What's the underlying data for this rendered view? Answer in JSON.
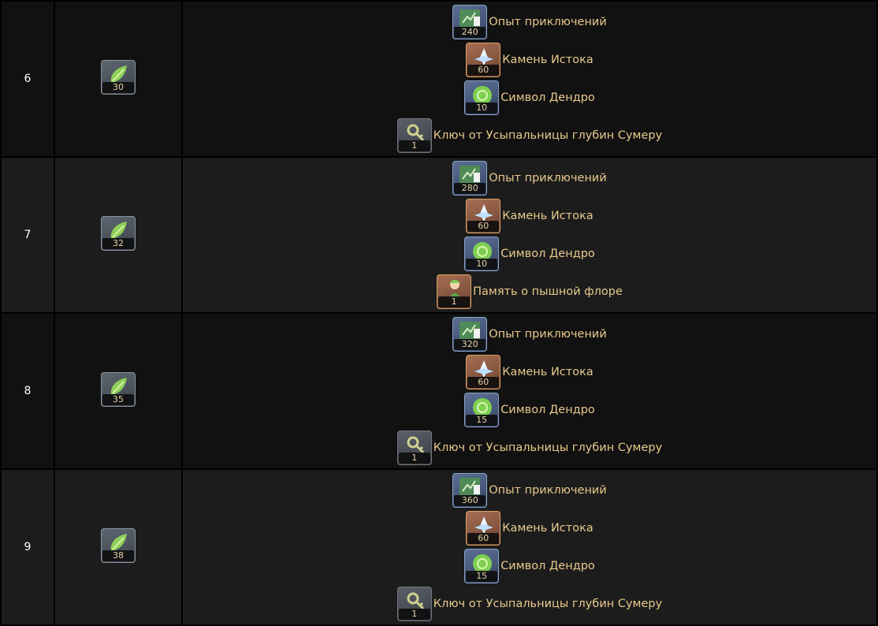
{
  "rows": [
    {
      "level": "6",
      "cost": {
        "icon": "dendro-leaf-token-icon",
        "count": "30"
      },
      "rewards": [
        {
          "icon": "adventure-exp-icon",
          "count": "240",
          "name": "Опыт приключений"
        },
        {
          "icon": "primogem-icon",
          "count": "60",
          "name": "Камень Истока"
        },
        {
          "icon": "dendro-sigil-icon",
          "count": "10",
          "name": "Символ Дендро"
        },
        {
          "icon": "crypt-key-icon",
          "count": "1",
          "name": "Ключ от Усыпальницы глубин Сумеру"
        }
      ]
    },
    {
      "level": "7",
      "cost": {
        "icon": "dendro-leaf-token-icon",
        "count": "32"
      },
      "rewards": [
        {
          "icon": "adventure-exp-icon",
          "count": "280",
          "name": "Опыт приключений"
        },
        {
          "icon": "primogem-icon",
          "count": "60",
          "name": "Камень Истока"
        },
        {
          "icon": "dendro-sigil-icon",
          "count": "10",
          "name": "Символ Дендро"
        },
        {
          "icon": "flora-memory-figure-icon",
          "count": "1",
          "name": "Память о пышной флоре"
        }
      ]
    },
    {
      "level": "8",
      "cost": {
        "icon": "dendro-leaf-token-icon",
        "count": "35"
      },
      "rewards": [
        {
          "icon": "adventure-exp-icon",
          "count": "320",
          "name": "Опыт приключений"
        },
        {
          "icon": "primogem-icon",
          "count": "60",
          "name": "Камень Истока"
        },
        {
          "icon": "dendro-sigil-icon",
          "count": "15",
          "name": "Символ Дендро"
        },
        {
          "icon": "crypt-key-icon",
          "count": "1",
          "name": "Ключ от Усыпальницы глубин Сумеру"
        }
      ]
    },
    {
      "level": "9",
      "cost": {
        "icon": "dendro-leaf-token-icon",
        "count": "38"
      },
      "rewards": [
        {
          "icon": "adventure-exp-icon",
          "count": "360",
          "name": "Опыт приключений"
        },
        {
          "icon": "primogem-icon",
          "count": "60",
          "name": "Камень Истока"
        },
        {
          "icon": "dendro-sigil-icon",
          "count": "15",
          "name": "Символ Дендро"
        },
        {
          "icon": "crypt-key-icon",
          "count": "1",
          "name": "Ключ от Усыпальницы глубин Сумеру"
        }
      ]
    }
  ]
}
